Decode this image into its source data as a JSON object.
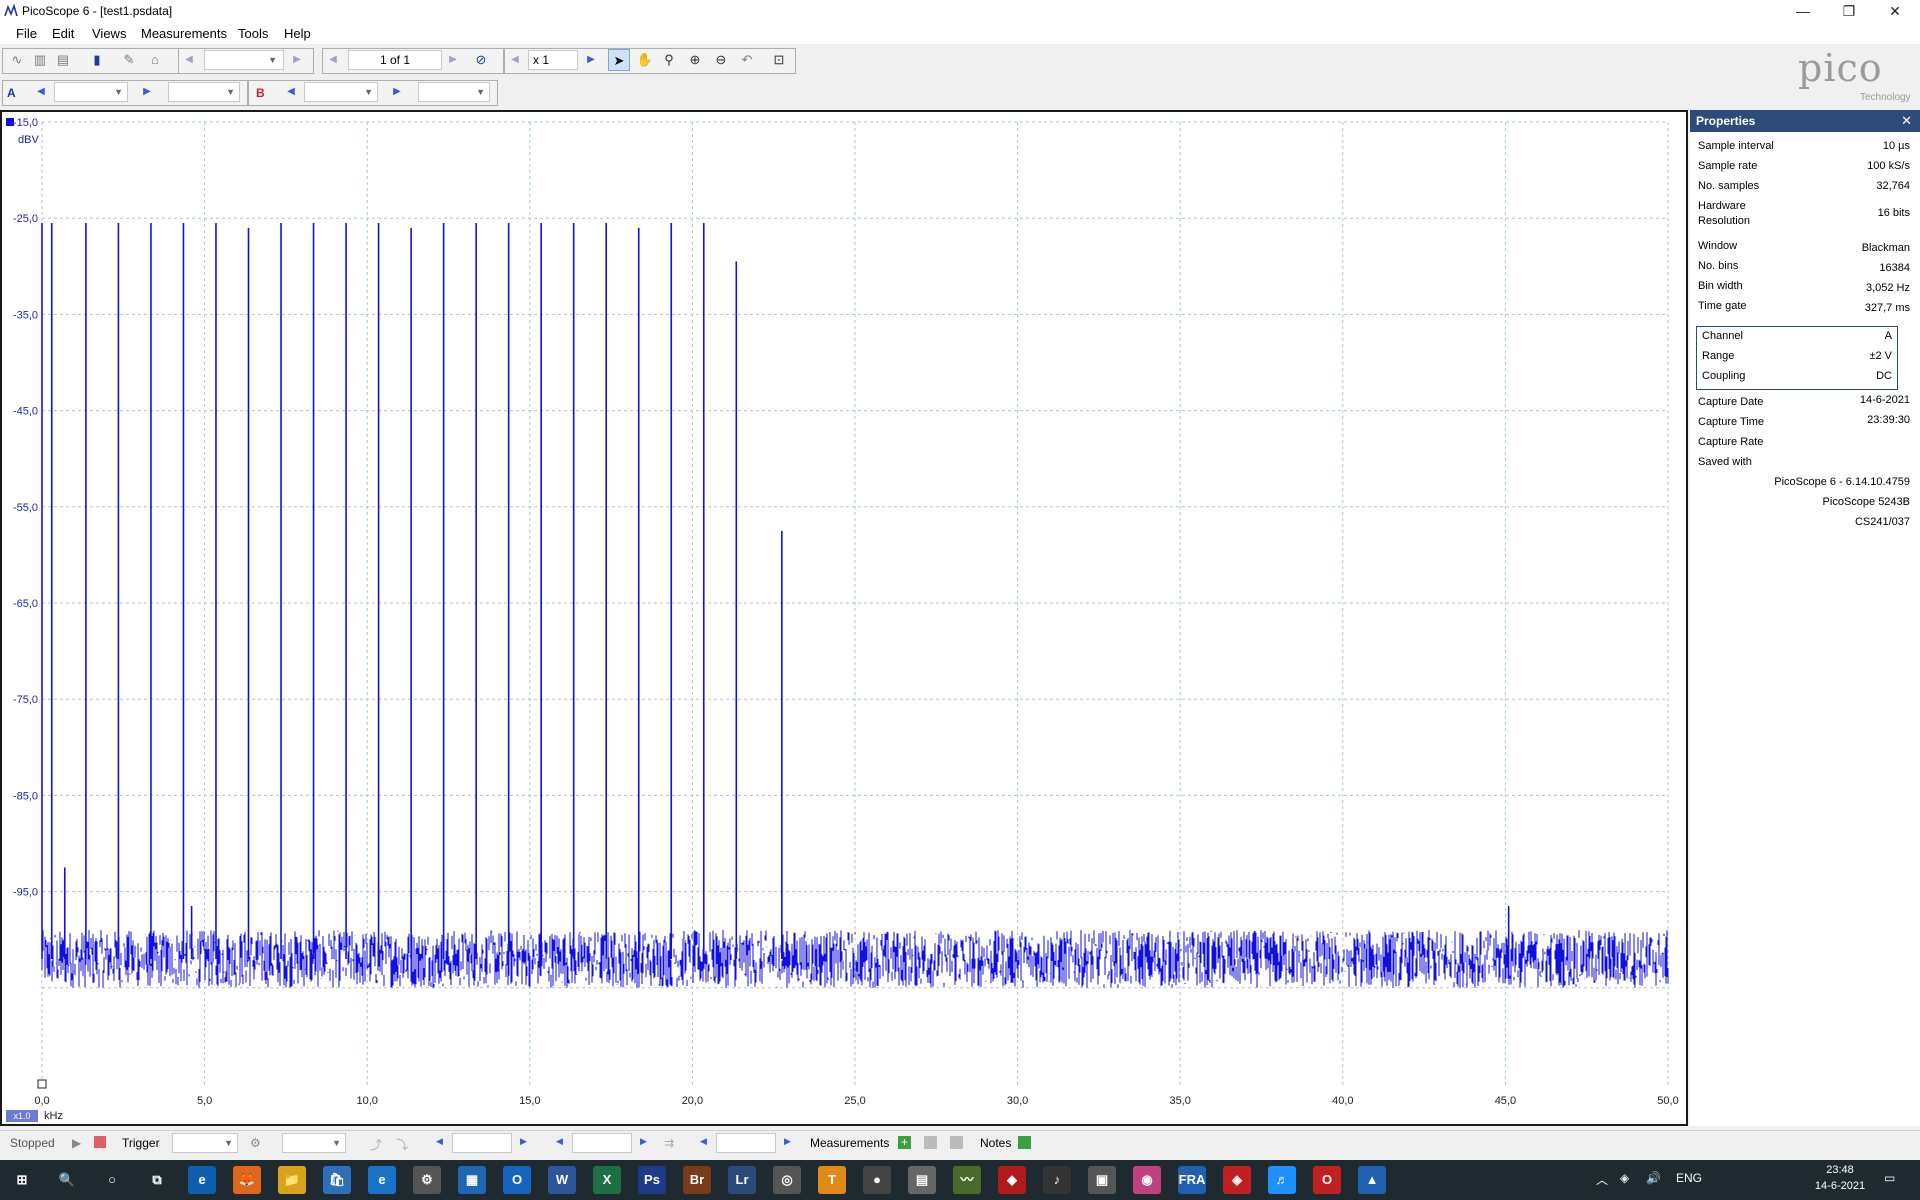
{
  "window": {
    "title": "PicoScope 6 - [test1.psdata]",
    "min": "—",
    "max": "❐",
    "close": "✕"
  },
  "menu": [
    {
      "label": "File"
    },
    {
      "label": "Edit"
    },
    {
      "label": "Views"
    },
    {
      "label": "Measurements"
    },
    {
      "label": "Tools"
    },
    {
      "label": "Help"
    }
  ],
  "toolbar": {
    "page_of": "1 of 1",
    "zoom": "x 1",
    "logo": "pico",
    "logo_sub": "Technology"
  },
  "channels": {
    "a_label": "A",
    "b_label": "B"
  },
  "plot": {
    "y_unit": "dBV",
    "x_unit": "kHz",
    "x_scale_badge": "x1.0"
  },
  "chart_data": {
    "type": "line",
    "title": "",
    "xlabel": "kHz",
    "ylabel": "dBV",
    "xlim": [
      0,
      50
    ],
    "ylim": [
      -110,
      -15
    ],
    "grid": true,
    "y_ticks": [
      "-15,0",
      "-25,0",
      "-35,0",
      "-45,0",
      "-55,0",
      "-65,0",
      "-75,0",
      "-85,0",
      "-95,0"
    ],
    "y_tick_values": [
      -15,
      -25,
      -35,
      -45,
      -55,
      -65,
      -75,
      -85,
      -95
    ],
    "x_ticks": [
      "0,0",
      "5,0",
      "10,0",
      "15,0",
      "20,0",
      "25,0",
      "30,0",
      "35,0",
      "40,0",
      "45,0",
      "50,0"
    ],
    "x_tick_values": [
      0,
      5,
      10,
      15,
      20,
      25,
      30,
      35,
      40,
      45,
      50
    ],
    "noise_floor_dBV": -102,
    "noise_floor_span_dB": 6,
    "series": [
      {
        "color": "#1010e0",
        "peaks": [
          {
            "f": 0.0,
            "dbv": -25.5
          },
          {
            "f": 0.3,
            "dbv": -25.5
          },
          {
            "f": 1.35,
            "dbv": -25.5
          },
          {
            "f": 2.35,
            "dbv": -25.5
          },
          {
            "f": 3.35,
            "dbv": -25.5
          },
          {
            "f": 4.35,
            "dbv": -25.5
          },
          {
            "f": 5.35,
            "dbv": -25.5
          },
          {
            "f": 6.35,
            "dbv": -26.0
          },
          {
            "f": 7.35,
            "dbv": -25.5
          },
          {
            "f": 8.35,
            "dbv": -25.5
          },
          {
            "f": 9.35,
            "dbv": -25.5
          },
          {
            "f": 10.35,
            "dbv": -25.5
          },
          {
            "f": 11.35,
            "dbv": -26.0
          },
          {
            "f": 12.35,
            "dbv": -25.5
          },
          {
            "f": 13.35,
            "dbv": -25.5
          },
          {
            "f": 14.35,
            "dbv": -25.5
          },
          {
            "f": 15.35,
            "dbv": -25.5
          },
          {
            "f": 16.35,
            "dbv": -25.5
          },
          {
            "f": 17.35,
            "dbv": -25.5
          },
          {
            "f": 18.35,
            "dbv": -26.0
          },
          {
            "f": 19.35,
            "dbv": -25.5
          },
          {
            "f": 20.35,
            "dbv": -25.5
          },
          {
            "f": 21.35,
            "dbv": -29.5
          },
          {
            "f": 22.75,
            "dbv": -57.5
          },
          {
            "f": 45.1,
            "dbv": -96.5
          },
          {
            "f": 0.7,
            "dbv": -92.5
          },
          {
            "f": 4.6,
            "dbv": -96.5
          }
        ]
      }
    ]
  },
  "properties": {
    "title": "Properties",
    "close": "✕",
    "rows1": [
      {
        "label": "Sample interval",
        "value": "10 µs"
      },
      {
        "label": "Sample rate",
        "value": "100 kS/s"
      },
      {
        "label": "No. samples",
        "value": "32,764"
      },
      {
        "label": "Hardware",
        "label2": "Resolution",
        "value": "16 bits"
      }
    ],
    "rows2": [
      {
        "label": "Window",
        "value": "Blackman"
      },
      {
        "label": "No. bins",
        "value": "16384"
      },
      {
        "label": "Bin width",
        "value": "3,052 Hz"
      },
      {
        "label": "Time gate",
        "value": "327,7 ms"
      }
    ],
    "channel": [
      {
        "label": "Channel",
        "value": "A"
      },
      {
        "label": "Range",
        "value": "±2 V"
      },
      {
        "label": "Coupling",
        "value": "DC"
      }
    ],
    "rows3": [
      {
        "label": "Capture Date",
        "value": "14-6-2021"
      },
      {
        "label": "Capture Time",
        "value": "23:39:30"
      },
      {
        "label": "Capture Rate",
        "value": ""
      },
      {
        "label": "Saved with",
        "value": ""
      }
    ],
    "saved": [
      "PicoScope 6 - 6.14.10.4759",
      "PicoScope 5243B",
      "CS241/037"
    ]
  },
  "status": {
    "state": "Stopped",
    "trigger": "Trigger",
    "measurements": "Measurements",
    "notes": "Notes"
  },
  "taskbar": {
    "apps": [
      "⊞",
      "🔍",
      "○",
      "⧉",
      "e",
      "🦊",
      "📁",
      "🛍",
      "e",
      "⚙",
      "▦",
      "O",
      "W",
      "X",
      "Ps",
      "Br",
      "Lr",
      "◎",
      "T",
      "●",
      "▤",
      "〰",
      "◆",
      "♪",
      "▣",
      "◉",
      "FRA",
      "◈",
      "♬",
      "O",
      "▲"
    ],
    "lang": "ENG",
    "time": "23:48",
    "date": "14-6-2021"
  }
}
